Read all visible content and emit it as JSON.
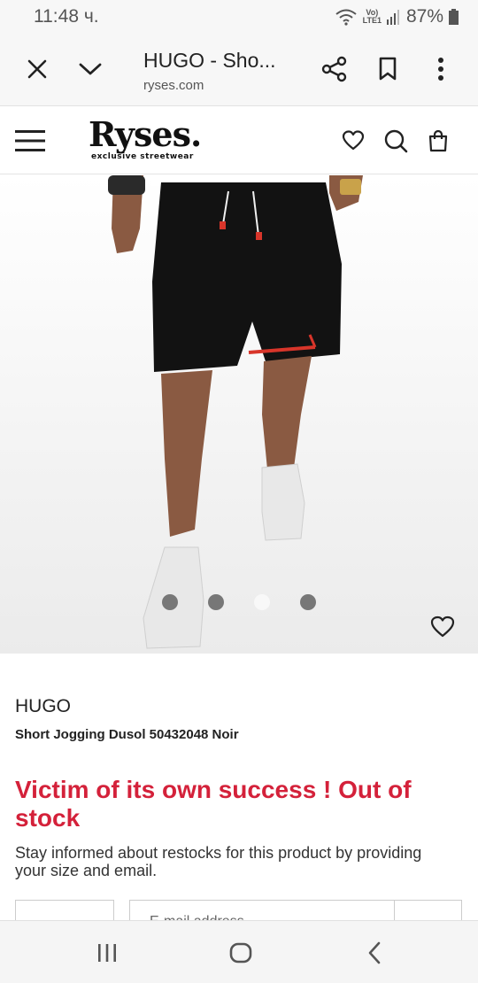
{
  "status_bar": {
    "time": "11:48 ч.",
    "network_label_top": "Vo)",
    "network_label_bottom": "LTE1",
    "battery": "87%"
  },
  "browser": {
    "tab_title": "HUGO - Sho...",
    "url": "ryses.com",
    "icons": [
      "close-icon",
      "chevron-down-icon",
      "share-icon",
      "bookmark-icon",
      "more-vert-icon"
    ]
  },
  "site_header": {
    "logo": "Ryses.",
    "tagline": "exclusive streetwear",
    "icons": [
      "menu-icon",
      "heart-icon",
      "search-icon",
      "bag-icon"
    ]
  },
  "gallery": {
    "slide_count": 4,
    "active_slide": 3
  },
  "product": {
    "brand": "HUGO",
    "name": "Short Jogging Dusol 50432048 Noir",
    "stock_message": "Victim of its own success ! Out of stock",
    "restock_message": "Stay informed about restocks for this product by providing your size and email.",
    "email_placeholder": "E-mail address"
  },
  "system_nav": {
    "icons": [
      "recents-icon",
      "home-icon",
      "back-icon"
    ]
  },
  "colors": {
    "accent_red": "#d4213a",
    "chrome_bg": "#f7f7f7"
  }
}
